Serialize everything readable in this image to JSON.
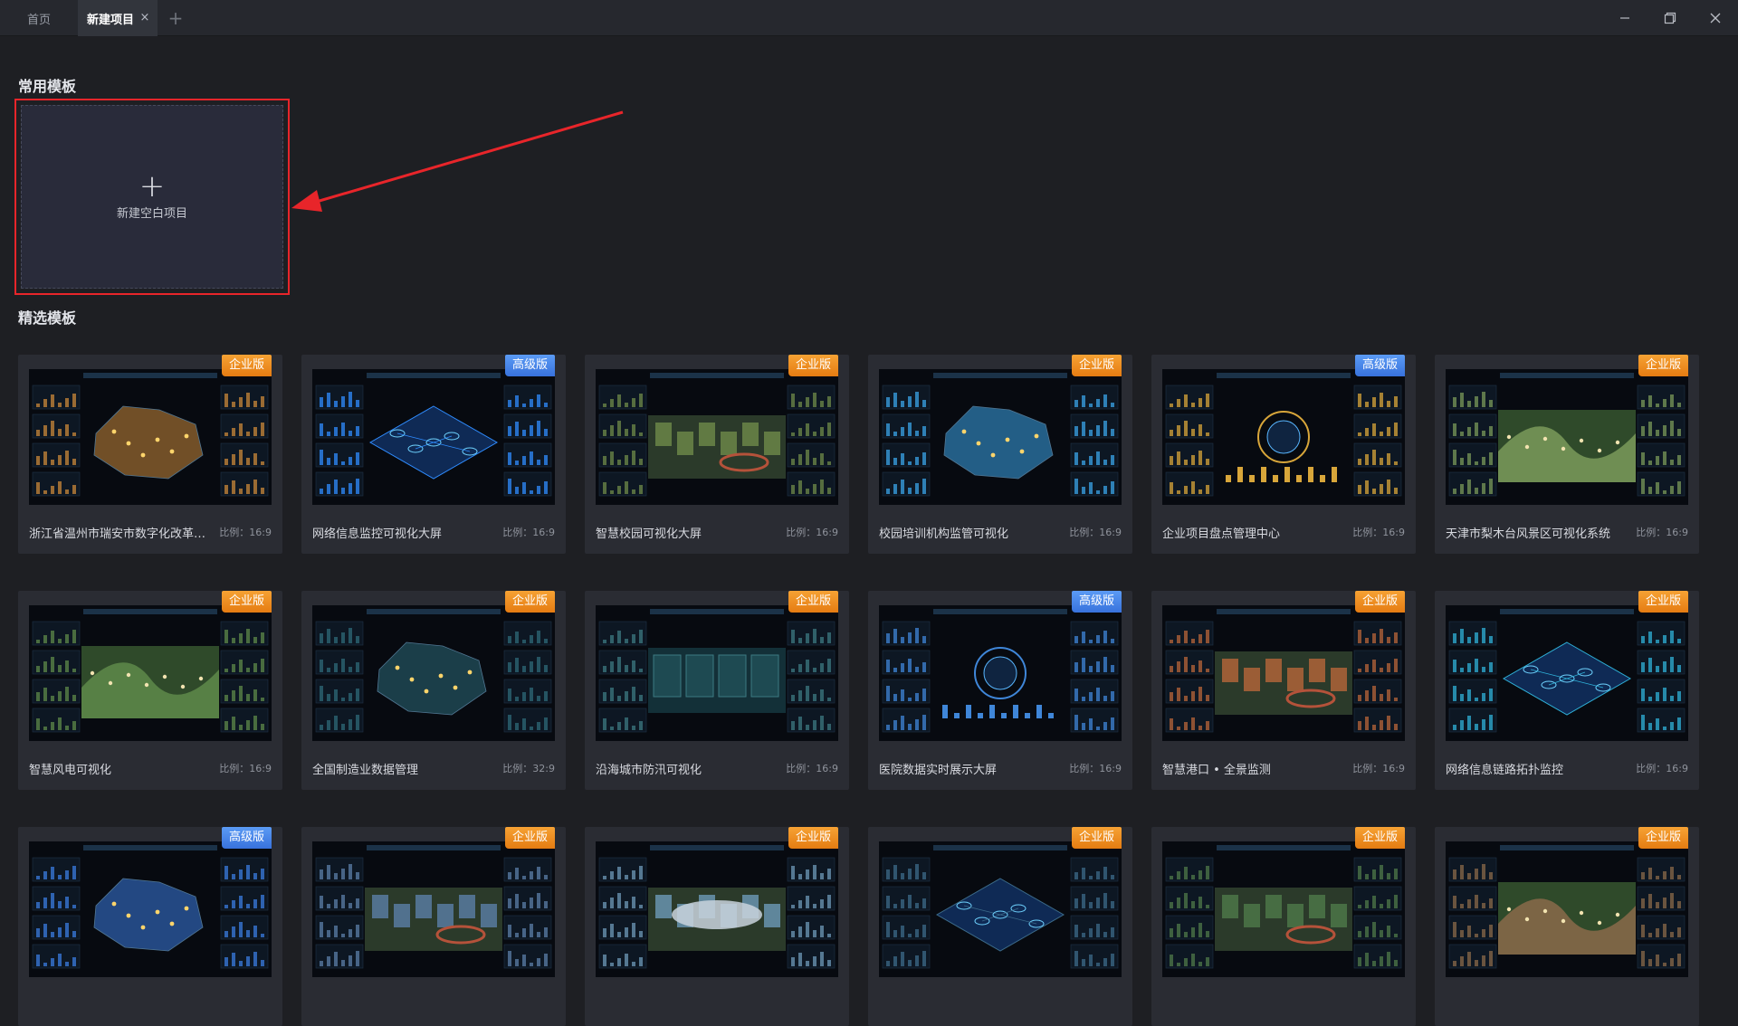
{
  "tabs": {
    "home_label": "首页",
    "active_label": "新建项目",
    "close_glyph": "×",
    "add_glyph": "+"
  },
  "window_controls": [
    "minimize-icon",
    "restore-icon",
    "close-icon"
  ],
  "common": {
    "title": "常用模板",
    "blank_project_label": "新建空白项目",
    "plus_glyph": "+"
  },
  "featured": {
    "title": "精选模板",
    "templates": [
      {
        "name": "浙江省温州市瑞安市数字化改革数据驾驶舱",
        "ratio": "比例：16:9",
        "badge": "企业版",
        "tier": "ent",
        "accent": "#c9883a",
        "scene": "map"
      },
      {
        "name": "网络信息监控可视化大屏",
        "ratio": "比例：16:9",
        "badge": "高级版",
        "tier": "adv",
        "accent": "#2f8cff",
        "scene": "iso"
      },
      {
        "name": "智慧校园可视化大屏",
        "ratio": "比例：16:9",
        "badge": "企业版",
        "tier": "ent",
        "accent": "#6f8b4a",
        "scene": "campus"
      },
      {
        "name": "校园培训机构监管可视化",
        "ratio": "比例：16:9",
        "badge": "企业版",
        "tier": "ent",
        "accent": "#3aa4e8",
        "scene": "map"
      },
      {
        "name": "企业项目盘点管理中心",
        "ratio": "比例：16:9",
        "badge": "高级版",
        "tier": "adv",
        "accent": "#d8a63a",
        "scene": "dashboard"
      },
      {
        "name": "天津市梨木台风景区可视化系统",
        "ratio": "比例：16:9",
        "badge": "企业版",
        "tier": "ent",
        "accent": "#7a9a5a",
        "scene": "landscape"
      },
      {
        "name": "智慧风电可视化",
        "ratio": "比例：16:9",
        "badge": "企业版",
        "tier": "ent",
        "accent": "#5e8a4a",
        "scene": "landscape"
      },
      {
        "name": "全国制造业数据管理",
        "ratio": "比例：32:9",
        "badge": "企业版",
        "tier": "ent",
        "accent": "#2d6a78",
        "scene": "map"
      },
      {
        "name": "沿海城市防汛可视化",
        "ratio": "比例：16:9",
        "badge": "企业版",
        "tier": "ent",
        "accent": "#3c7a82",
        "scene": "panels"
      },
      {
        "name": "医院数据实时展示大屏",
        "ratio": "比例：16:9",
        "badge": "高级版",
        "tier": "adv",
        "accent": "#3f86d8",
        "scene": "dashboard"
      },
      {
        "name": "智慧港口 • 全景监测",
        "ratio": "比例：16:9",
        "badge": "企业版",
        "tier": "ent",
        "accent": "#b8663a",
        "scene": "campus"
      },
      {
        "name": "网络信息链路拓扑监控",
        "ratio": "比例：16:9",
        "badge": "企业版",
        "tier": "ent",
        "accent": "#2fb1d8",
        "scene": "iso"
      },
      {
        "name": "",
        "ratio": "",
        "badge": "高级版",
        "tier": "adv",
        "accent": "#3a7ce0",
        "scene": "map"
      },
      {
        "name": "",
        "ratio": "",
        "badge": "企业版",
        "tier": "ent",
        "accent": "#5b7fa8",
        "scene": "campus"
      },
      {
        "name": "",
        "ratio": "",
        "badge": "企业版",
        "tier": "ent",
        "accent": "#6d9ab8",
        "scene": "stadium"
      },
      {
        "name": "",
        "ratio": "",
        "badge": "企业版",
        "tier": "ent",
        "accent": "#3c6b8a",
        "scene": "iso"
      },
      {
        "name": "",
        "ratio": "",
        "badge": "企业版",
        "tier": "ent",
        "accent": "#4f7a4a",
        "scene": "campus"
      },
      {
        "name": "",
        "ratio": "",
        "badge": "企业版",
        "tier": "ent",
        "accent": "#8a6a4a",
        "scene": "landscape"
      }
    ]
  }
}
